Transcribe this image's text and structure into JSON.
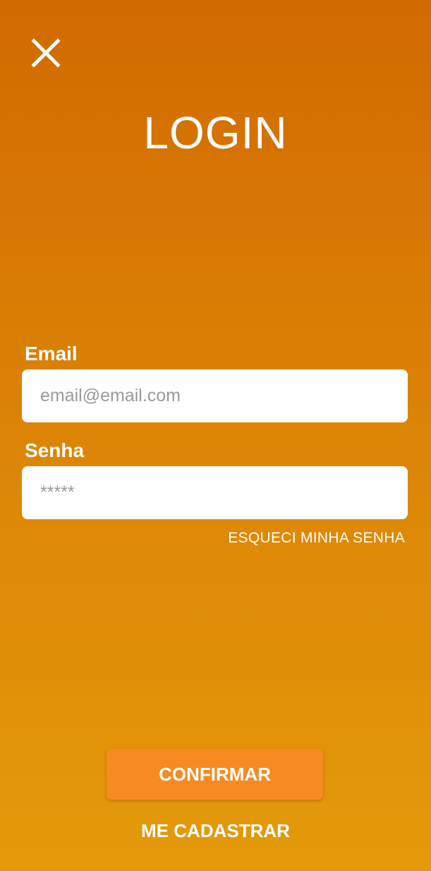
{
  "header": {
    "close_icon": "close-icon",
    "title": "LOGIN"
  },
  "form": {
    "email_label": "Email",
    "email_placeholder": "email@email.com",
    "email_value": "",
    "senha_label": "Senha",
    "senha_placeholder": "*****",
    "senha_value": "",
    "forgot_label": "ESQUECI MINHA SENHA"
  },
  "actions": {
    "confirm_label": "CONFIRMAR",
    "register_label": "ME CADASTRAR"
  },
  "colors": {
    "background_top": "#D16A00",
    "background_bottom": "#E49A0A",
    "button": "#F68A23",
    "text": "#FFFFFF",
    "input_bg": "#FFFFFF",
    "placeholder": "#9A9A9A"
  }
}
